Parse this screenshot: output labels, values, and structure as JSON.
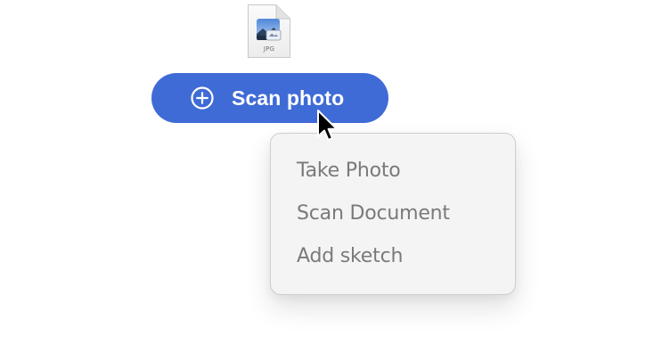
{
  "file": {
    "type_label": "JPG",
    "icon": "jpg-file-icon"
  },
  "scan_button": {
    "label": "Scan photo",
    "icon": "plus-circle-icon",
    "color": "#3f6bd6"
  },
  "cursor": {
    "icon": "arrow-cursor-icon"
  },
  "menu": {
    "items": [
      {
        "label": "Take Photo"
      },
      {
        "label": "Scan Document"
      },
      {
        "label": "Add sketch"
      }
    ]
  }
}
